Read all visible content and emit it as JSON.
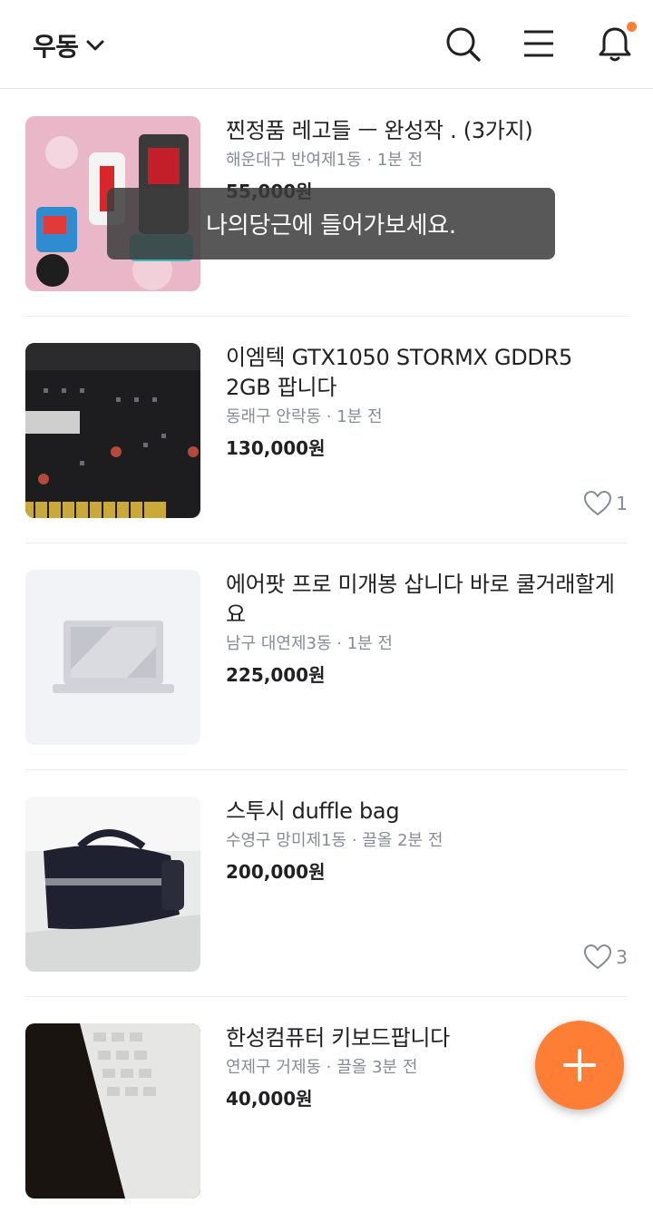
{
  "header": {
    "location": "우동",
    "icons": [
      "search-icon",
      "menu-icon",
      "bell-icon"
    ],
    "accent_color": "#ff7e36"
  },
  "items": [
    {
      "title": "찐정품  레고들 ㅡ 완성작  .   (3가지)",
      "meta": "해운대구 반여제1동 · 1분 전",
      "price": "55,000원",
      "likes": null
    },
    {
      "title": "이엠텍 GTX1050 STORMX GDDR5 2GB 팝니다",
      "meta": "동래구 안락동 · 1분 전",
      "price": "130,000원",
      "likes": "1"
    },
    {
      "title": "에어팟 프로 미개봉 삽니다 바로 쿨거래할게요",
      "meta": "남구 대연제3동 · 1분 전",
      "price": "225,000원",
      "likes": null
    },
    {
      "title": "스투시 duffle bag",
      "meta": "수영구 망미제1동 · 끌올 2분 전",
      "price": "200,000원",
      "likes": "3"
    },
    {
      "title": "한성컴퓨터 키보드팝니다",
      "meta": "연제구 거제동 · 끌올 3분 전",
      "price": "40,000원",
      "likes": null
    }
  ],
  "toast": "나의당근에 들어가보세요."
}
